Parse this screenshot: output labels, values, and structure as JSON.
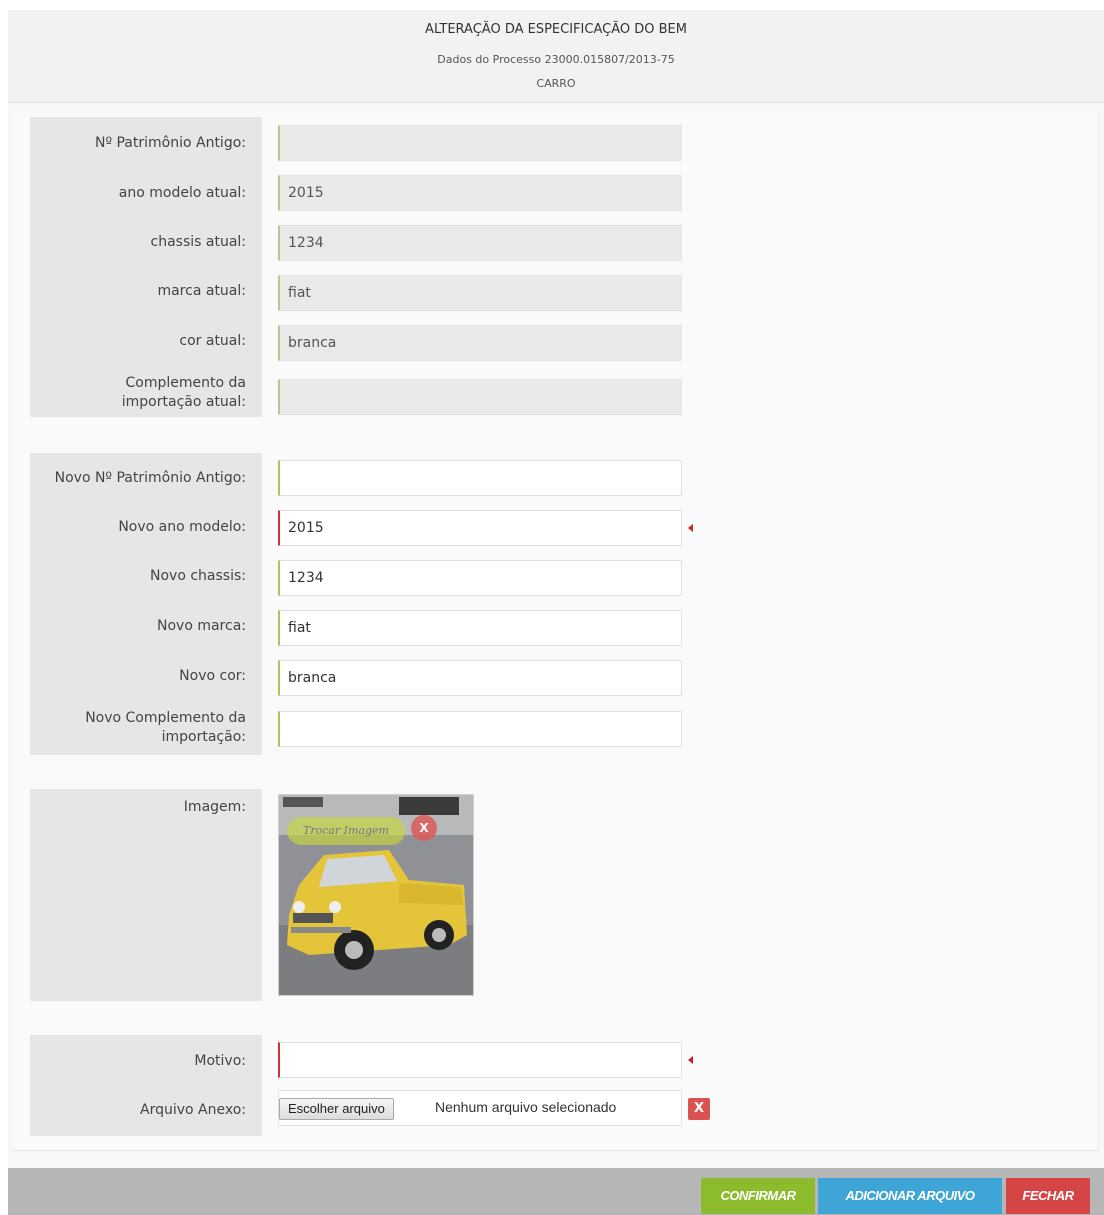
{
  "header": {
    "title": "ALTERAÇÃO DA ESPECIFICAÇÃO DO BEM",
    "subtitle": "Dados do Processo 23000.015807/2013-75",
    "item": "CARRO"
  },
  "current": {
    "patrimonio_label": "Nº Patrimônio Antigo:",
    "patrimonio_value": "",
    "ano_label": "ano modelo atual:",
    "ano_value": "2015",
    "chassis_label": "chassis atual:",
    "chassis_value": "1234",
    "marca_label": "marca atual:",
    "marca_value": "fiat",
    "cor_label": "cor atual:",
    "cor_value": "branca",
    "complemento_label_1": "Complemento da",
    "complemento_label_2": "importação atual:",
    "complemento_value": ""
  },
  "new": {
    "patrimonio_label": "Novo Nº Patrimônio Antigo:",
    "patrimonio_value": "",
    "ano_label": "Novo ano modelo:",
    "ano_value": "2015",
    "chassis_label": "Novo chassis:",
    "chassis_value": "1234",
    "marca_label": "Novo marca:",
    "marca_value": "fiat",
    "cor_label": "Novo cor:",
    "cor_value": "branca",
    "complemento_label_1": "Novo Complemento da",
    "complemento_label_2": "importação:",
    "complemento_value": ""
  },
  "image": {
    "label": "Imagem:",
    "trocar_label": "Trocar Imagem",
    "remove_label": "X"
  },
  "reason": {
    "motivo_label": "Motivo:",
    "motivo_value": "",
    "arquivo_label": "Arquivo Anexo:",
    "file_button": "Escolher arquivo",
    "file_status": "Nenhum arquivo selecionado",
    "remove_label": "X"
  },
  "footer": {
    "confirm": "CONFIRMAR",
    "add_file": "ADICIONAR ARQUIVO",
    "close": "FECHAR"
  },
  "colors": {
    "confirm": "#8cbb2e",
    "add_file": "#3fa5d6",
    "close": "#d64545",
    "required": "#cc2222"
  }
}
